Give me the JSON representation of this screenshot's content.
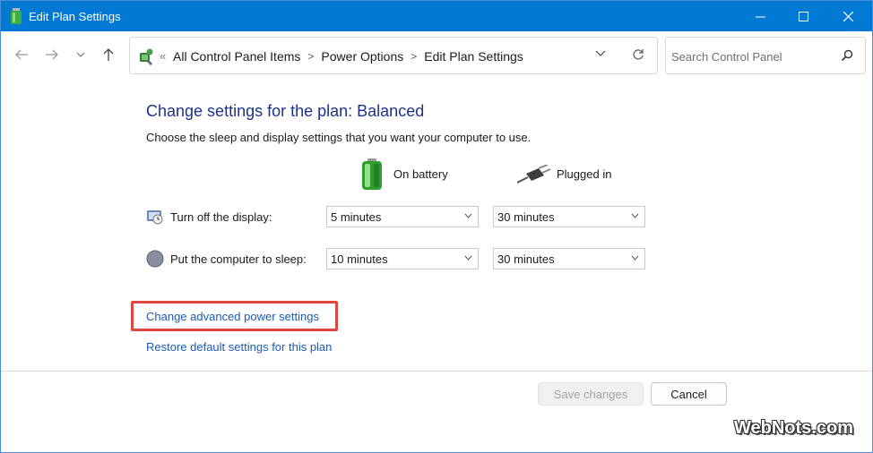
{
  "window": {
    "title": "Edit Plan Settings",
    "accent": "#0078d4"
  },
  "nav": {
    "breadcrumb_prefix": "«",
    "breadcrumbs": [
      "All Control Panel Items",
      "Power Options",
      "Edit Plan Settings"
    ],
    "search_placeholder": "Search Control Panel"
  },
  "content": {
    "heading": "Change settings for the plan: Balanced",
    "subtitle": "Choose the sleep and display settings that you want your computer to use.",
    "columns": {
      "battery": "On battery",
      "plugged": "Plugged in"
    },
    "rows": [
      {
        "label": "Turn off the display:",
        "battery_value": "5 minutes",
        "plugged_value": "30 minutes"
      },
      {
        "label": "Put the computer to sleep:",
        "battery_value": "10 minutes",
        "plugged_value": "30 minutes"
      }
    ],
    "links": {
      "advanced": "Change advanced power settings",
      "restore": "Restore default settings for this plan"
    }
  },
  "buttons": {
    "save": "Save changes",
    "cancel": "Cancel"
  },
  "watermark": "WebNots.com",
  "colors": {
    "heading": "#1e3287",
    "link": "#1c5ab3",
    "highlight": "#e0463f"
  }
}
